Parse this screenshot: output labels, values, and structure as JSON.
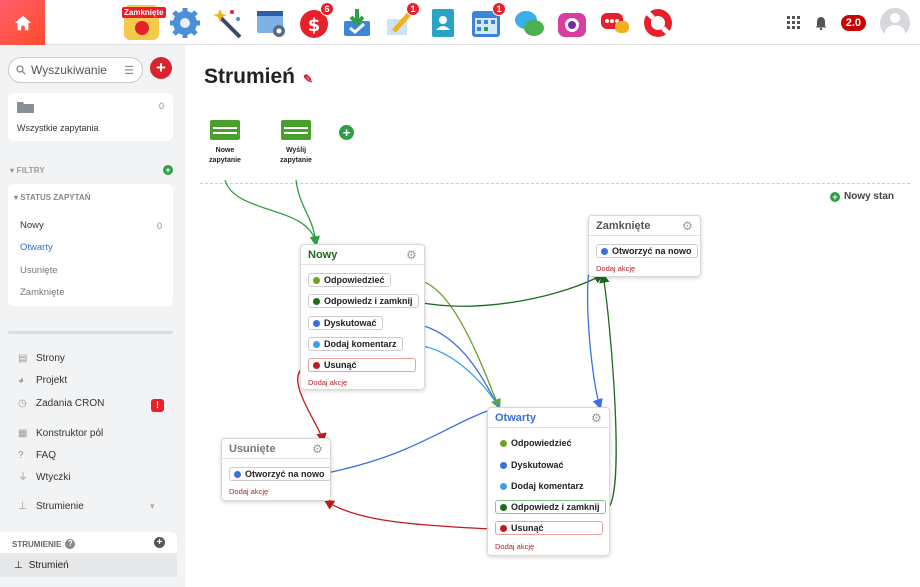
{
  "topbar": {
    "app_badge_label": "Zamknięte",
    "badges": {
      "app4": "6",
      "app6": "1",
      "app8": "1"
    },
    "version": "2.0"
  },
  "sidebar": {
    "search_placeholder": "Wyszukiwanie",
    "all_requests": {
      "label": "Wszystkie zapytania",
      "count": "0"
    },
    "filters_title": "FILTRY",
    "status_title": "STATUS ZAPYTAŃ",
    "statuses": [
      {
        "label": "Nowy",
        "count": "0"
      },
      {
        "label": "Otwarty",
        "count": ""
      },
      {
        "label": "Usunięte",
        "count": ""
      },
      {
        "label": "Zamknięte",
        "count": ""
      }
    ],
    "nav": [
      {
        "label": "Strony",
        "icon": "page-icon"
      },
      {
        "label": "Projekt",
        "icon": "palette-icon"
      },
      {
        "label": "Zadania CRON",
        "icon": "clock-icon"
      },
      {
        "label": "Konstruktor pól",
        "icon": "form-icon"
      },
      {
        "label": "FAQ",
        "icon": "question-icon"
      },
      {
        "label": "Wtyczki",
        "icon": "plug-icon"
      },
      {
        "label": "Strumienie",
        "icon": "flow-icon"
      }
    ],
    "cron_badge": "!",
    "streams_title": "STRUMIENIE",
    "streams_selected": "Strumień"
  },
  "main": {
    "title": "Strumień",
    "triggers": [
      {
        "label_1": "Nowe",
        "label_2": "zapytanie"
      },
      {
        "label_1": "Wyślij",
        "label_2": "zapytanie"
      }
    ],
    "new_state_label": "Nowy stan",
    "add_action": "Dodaj akcję",
    "nodes": {
      "nowy": {
        "title": "Nowy",
        "actions": [
          "Odpowiedzieć",
          "Odpowiedz i zamknij",
          "Dyskutować",
          "Dodaj komentarz",
          "Usunąć"
        ]
      },
      "zamkniete": {
        "title": "Zamknięte",
        "actions": [
          "Otworzyć na nowo"
        ]
      },
      "usuniete": {
        "title": "Usunięte",
        "actions": [
          "Otworzyć na nowo"
        ]
      },
      "otwarty": {
        "title": "Otwarty",
        "actions": [
          "Odpowiedzieć",
          "Dyskutować",
          "Dodaj komentarz",
          "Odpowiedz i zamknij",
          "Usunąć"
        ]
      }
    }
  },
  "colors": {
    "accent_red": "#d9232d",
    "green_dark": "#1e6b1e",
    "green_light": "#6aa22a",
    "blue": "#3b6fe0",
    "light_blue": "#3aa0e8",
    "red_action": "#c21a1a",
    "link_blue": "#3072c9"
  }
}
